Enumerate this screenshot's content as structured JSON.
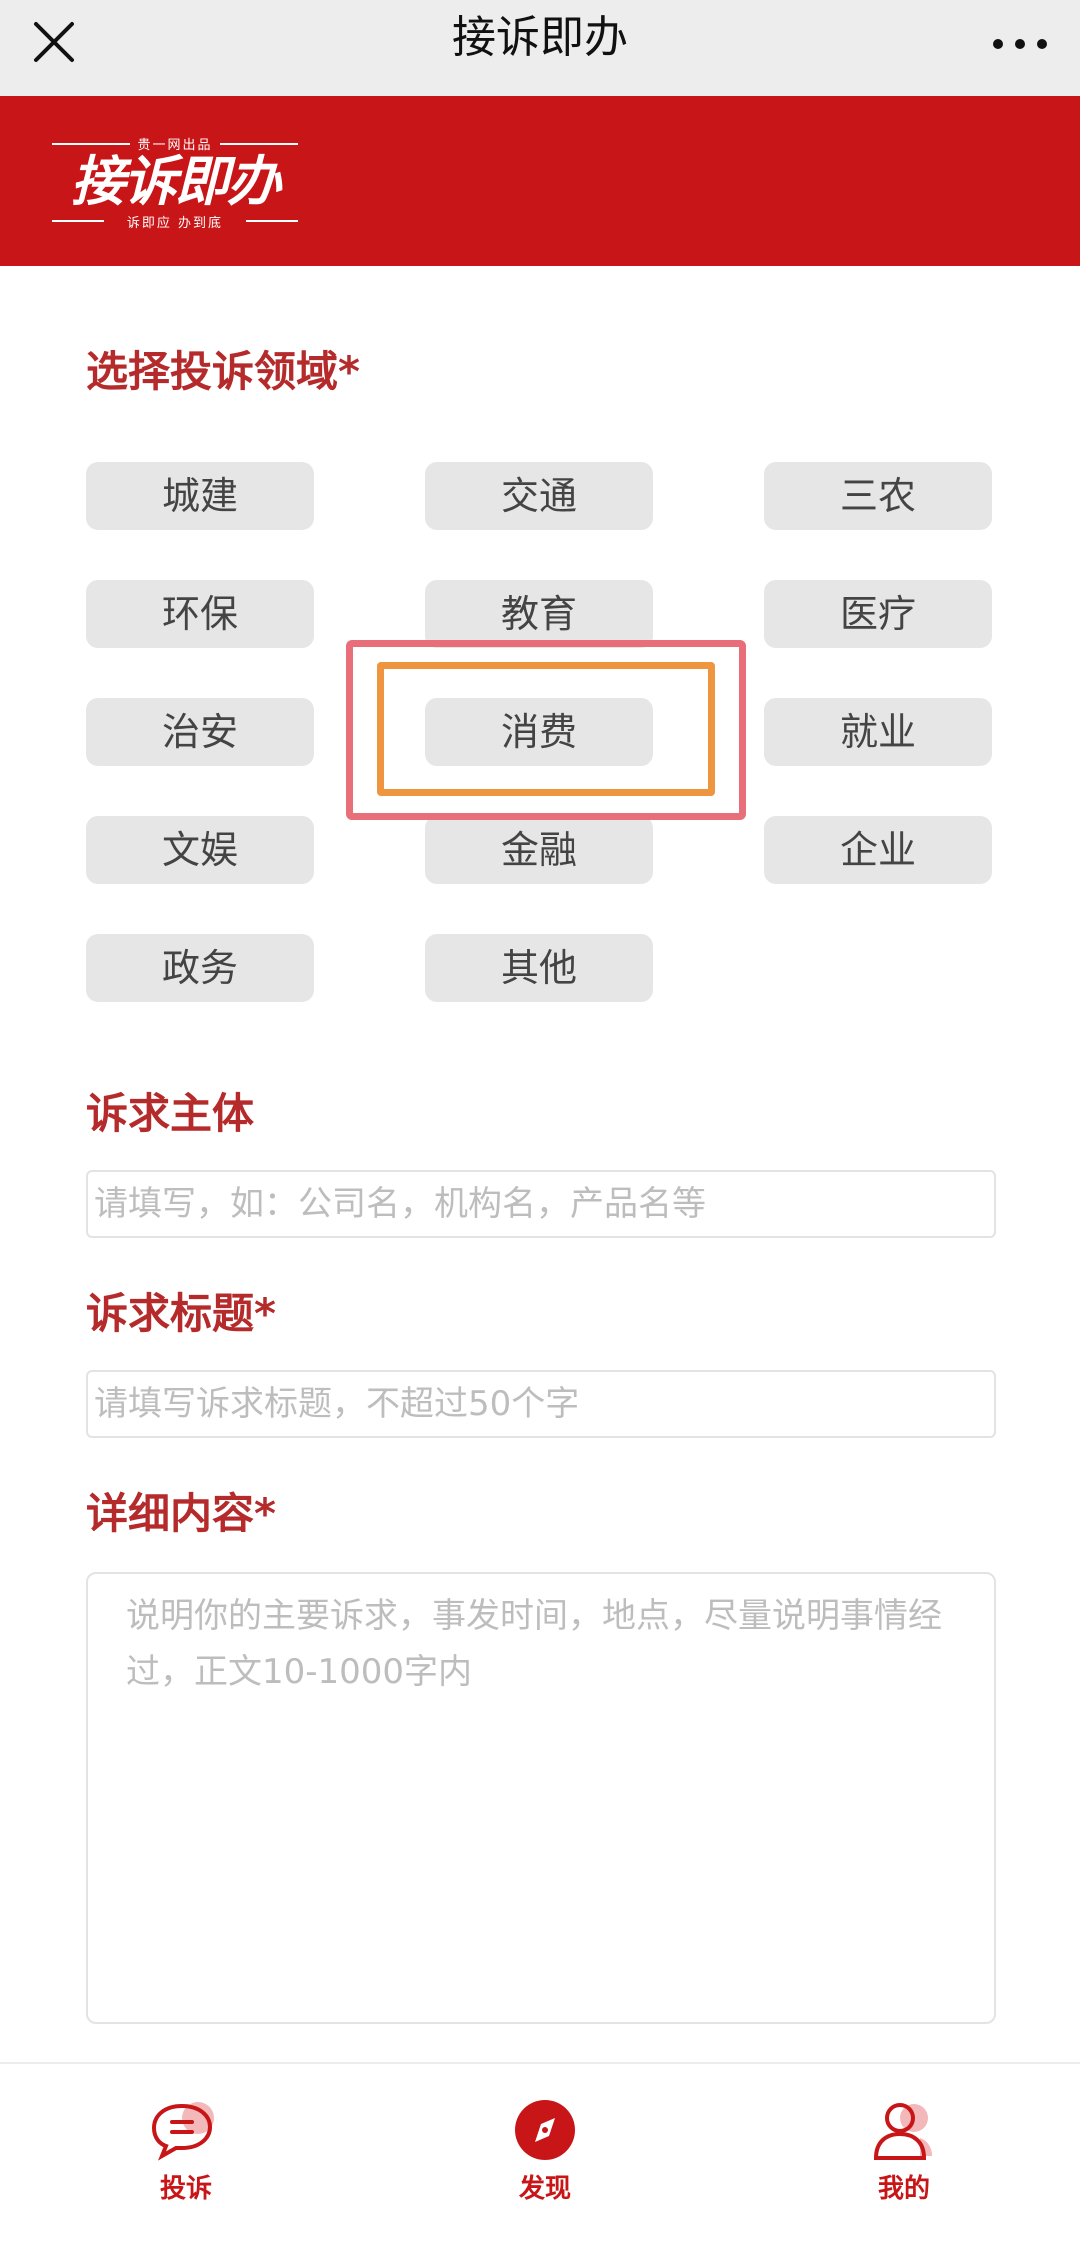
{
  "header": {
    "title": "接诉即办",
    "close_icon": "close-icon",
    "more_icon": "more-dots-icon"
  },
  "banner": {
    "logo_top": "贵一网出品",
    "logo_main": "接诉即办",
    "logo_sub": "诉即应 办到底",
    "color": "#c81517"
  },
  "form": {
    "category_title": "选择投诉领域*",
    "categories": [
      "城建",
      "交通",
      "三农",
      "环保",
      "教育",
      "医疗",
      "治安",
      "消费",
      "就业",
      "文娱",
      "金融",
      "企业",
      "政务",
      "其他"
    ],
    "highlighted_category": "消费",
    "subject": {
      "label": "诉求主体",
      "placeholder": "请填写，如：公司名，机构名，产品名等",
      "value": ""
    },
    "topic": {
      "label": "诉求标题*",
      "placeholder": "请填写诉求标题，不超过50个字",
      "value": ""
    },
    "detail": {
      "label": "详细内容*",
      "placeholder": "说明你的主要诉求，事发时间，地点，尽量说明事情经过，正文10-1000字内",
      "value": ""
    }
  },
  "tabbar": {
    "tabs": [
      {
        "label": "投诉",
        "icon": "chat-bubble-icon"
      },
      {
        "label": "发现",
        "icon": "compass-icon"
      },
      {
        "label": "我的",
        "icon": "user-icon"
      }
    ]
  },
  "colors": {
    "accent": "#c81517",
    "heading": "#b52a2a",
    "highlight_outer": "#e86e7a",
    "highlight_inner": "#f0953f"
  }
}
